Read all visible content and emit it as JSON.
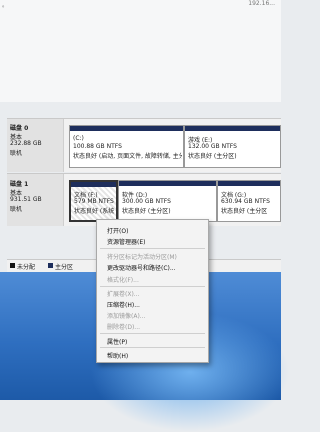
{
  "top": {
    "left_fragment": "。",
    "right_fragment": "192.16..."
  },
  "disk0": {
    "name": "磁盘 0",
    "type": "基本",
    "size": "232.88 GB",
    "status": "联机",
    "partitions": [
      {
        "label": "(C:)",
        "size": "100.88 GB NTFS",
        "status": "状态良好 (启动, 页面文件, 故障转储, 主分区)"
      },
      {
        "label": "游戏 (E:)",
        "size": "132.00 GB NTFS",
        "status": "状态良好 (主分区)"
      }
    ]
  },
  "disk1": {
    "name": "磁盘 1",
    "type": "基本",
    "size": "931.51 GB",
    "status": "联机",
    "partitions": [
      {
        "label": "文档 (F:)",
        "size": "579 MB NTFS",
        "status": "状态良好 (系统"
      },
      {
        "label": "软件 (D:)",
        "size": "300.00 GB NTFS",
        "status": "状态良好 (主分区)"
      },
      {
        "label": "文档 (G:)",
        "size": "630.94 GB NTFS",
        "status": "状态良好 (主分区"
      }
    ]
  },
  "legend": {
    "unallocated": "未分配",
    "primary": "主分区"
  },
  "colors": {
    "partition_bar": "#1e2e5c",
    "unallocated": "#111111",
    "primary": "#1e2e5c",
    "desktop": "#2f6fc0"
  },
  "context_menu": {
    "open": "打开(O)",
    "explorer": "资源管理器(E)",
    "mark_active": "将分区标记为活动分区(M)",
    "change_letter": "更改驱动器号和路径(C)...",
    "format": "格式化(F)...",
    "extend": "扩展卷(X)...",
    "shrink": "压缩卷(H)...",
    "add_mirror": "添加镜像(A)...",
    "delete": "删除卷(D)...",
    "properties": "属性(P)",
    "help": "帮助(H)"
  }
}
